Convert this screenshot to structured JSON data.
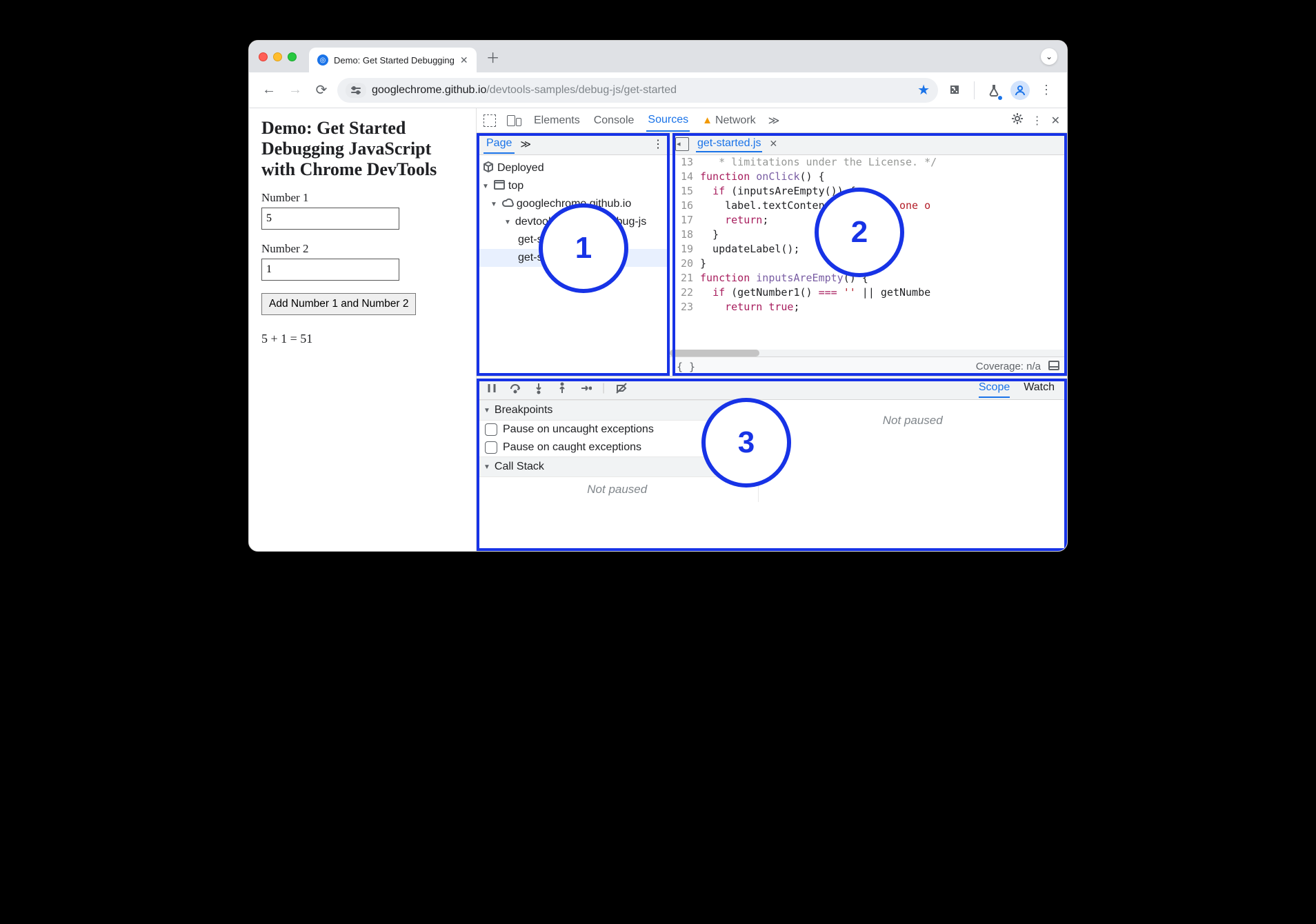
{
  "tab": {
    "title": "Demo: Get Started Debugging"
  },
  "url": {
    "host": "googlechrome.github.io",
    "path": "/devtools-samples/debug-js/get-started"
  },
  "page": {
    "heading": "Demo: Get Started Debugging JavaScript with Chrome DevTools",
    "num1_label": "Number 1",
    "num1_value": "5",
    "num2_label": "Number 2",
    "num2_value": "1",
    "button_label": "Add Number 1 and Number 2",
    "output": "5 + 1 = 51"
  },
  "devtools": {
    "tabs": [
      "Elements",
      "Console",
      "Sources",
      "Network"
    ],
    "navigator": {
      "tab": "Page",
      "items": [
        "Deployed",
        "top",
        "googlechrome.github.io",
        "devtools-samples/debug-js",
        "get-started",
        "get-started.js"
      ]
    },
    "editor": {
      "filename": "get-started.js",
      "coverage": "Coverage: n/a",
      "lines": [
        {
          "n": "13",
          "t": "   * limitations under the License. */"
        },
        {
          "n": "14",
          "fn": "onClick"
        },
        {
          "n": "15"
        },
        {
          "n": "16"
        },
        {
          "n": "17"
        },
        {
          "n": "18"
        },
        {
          "n": "19"
        },
        {
          "n": "20"
        },
        {
          "n": "21",
          "fn": "inputsAreEmpty"
        },
        {
          "n": "22"
        },
        {
          "n": "23"
        }
      ]
    },
    "debugger": {
      "tabs": [
        "Scope",
        "Watch"
      ],
      "sections": [
        "Breakpoints",
        "Call Stack"
      ],
      "checkboxes": [
        "Pause on uncaught exceptions",
        "Pause on caught exceptions"
      ],
      "not_paused": "Not paused"
    }
  },
  "annotations": [
    "1",
    "2",
    "3"
  ]
}
